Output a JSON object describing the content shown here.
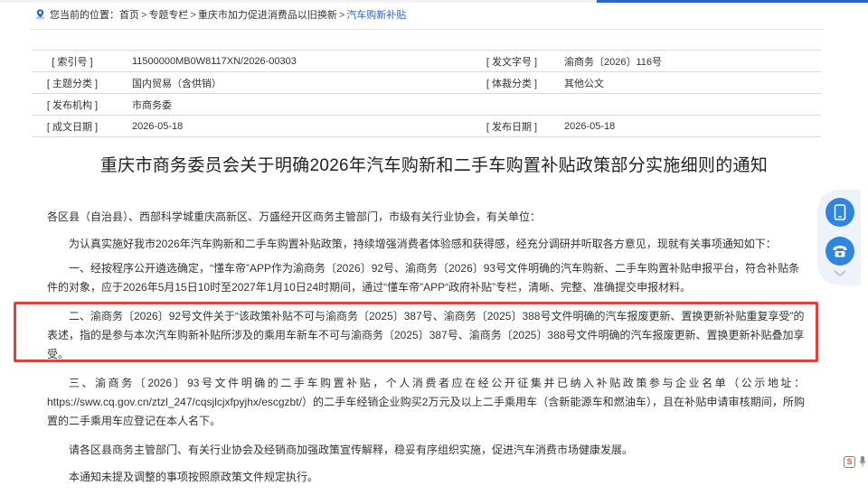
{
  "breadcrumb": {
    "prefix": "您当前的位置：",
    "items": [
      "首页",
      "专题专栏",
      "重庆市加力促进消费品以旧换新",
      "汽车购新补贴"
    ],
    "separator": ">"
  },
  "meta": {
    "rows": [
      {
        "k1": "[ 索引号 ]",
        "v1": "11500000MB0W8117XN/2026-00303",
        "k2": "[ 发文字号 ]",
        "v2": "渝商务〔2026〕116号"
      },
      {
        "k1": "[ 主题分类 ]",
        "v1": "国内贸易（含供销）",
        "k2": "[ 体裁分类 ]",
        "v2": "其他公文"
      },
      {
        "k1": "[ 发布机构 ]",
        "v1": "市商务委",
        "k2": "",
        "v2": ""
      },
      {
        "k1": "[ 成文日期 ]",
        "v1": "2026-05-18",
        "k2": "[ 发布日期 ]",
        "v2": "2026-05-18"
      }
    ]
  },
  "document": {
    "title": "重庆市商务委员会关于明确2026年汽车购新和二手车购置补贴政策部分实施细则的通知",
    "salutation": "各区县（自治县）、西部科学城重庆高新区、万盛经开区商务主管部门，市级有关行业协会，有关单位：",
    "intro": "为认真实施好我市2026年汽车购新和二手车购置补贴政策，持续增强消费者体验感和获得感，经充分调研并听取各方意见，现就有关事项通知如下：",
    "item1": "一、经按程序公开遴选确定，“懂车帝”APP作为渝商务〔2026〕92号、渝商务〔2026〕93号文件明确的汽车购新、二手车购置补贴申报平台，符合补贴条件的对象，应于2026年5月15日10时至2027年1月10日24时期间，通过“懂车帝”APP“政府补贴”专栏，清晰、完整、准确提交申报材料。",
    "item2": "二、渝商务〔2026〕92号文件关于“该政策补贴不可与渝商务〔2025〕387号、渝商务〔2025〕388号文件明确的汽车报废更新、置换更新补贴重复享受”的表述，指的是参与本次汽车购新补贴所涉及的乘用车新车不可与渝商务〔2025〕387号、渝商务〔2025〕388号文件明确的汽车报废更新、置换更新补贴叠加享受。",
    "item3": "三、渝商务〔2026〕93号文件明确的二手车购置补贴，个人消费者应在经公开征集并已纳入补贴政策参与企业名单（公示地址：https://sww.cq.gov.cn/ztzl_247/cqsjlcjxfpyjhx/escgzbt/）的二手车经销企业购买2万元及以上二手乘用车（含新能源车和燃油车），且在补贴申请审核期间，所购置的二手乘用车应登记在本人名下。",
    "closing": "请各区县商务主管部门、有关行业协会及经销商加强政策宣传解释，稳妥有序组织实施，促进汽车消费市场健康发展。",
    "note": "本通知未提及调整的事项按照原政策文件规定执行。"
  },
  "float_bar": {
    "icons": [
      "tablet-icon",
      "phone-icon",
      "chevron-down-icon"
    ]
  },
  "corner": {
    "badge": "S",
    "icons": [
      "sogou-icon",
      "microphone-icon"
    ]
  },
  "colors": {
    "link": "#2b64c5",
    "highlight": "#e63e3e",
    "float_button": "#2f86e0",
    "float_bg": "#eef3fb"
  }
}
